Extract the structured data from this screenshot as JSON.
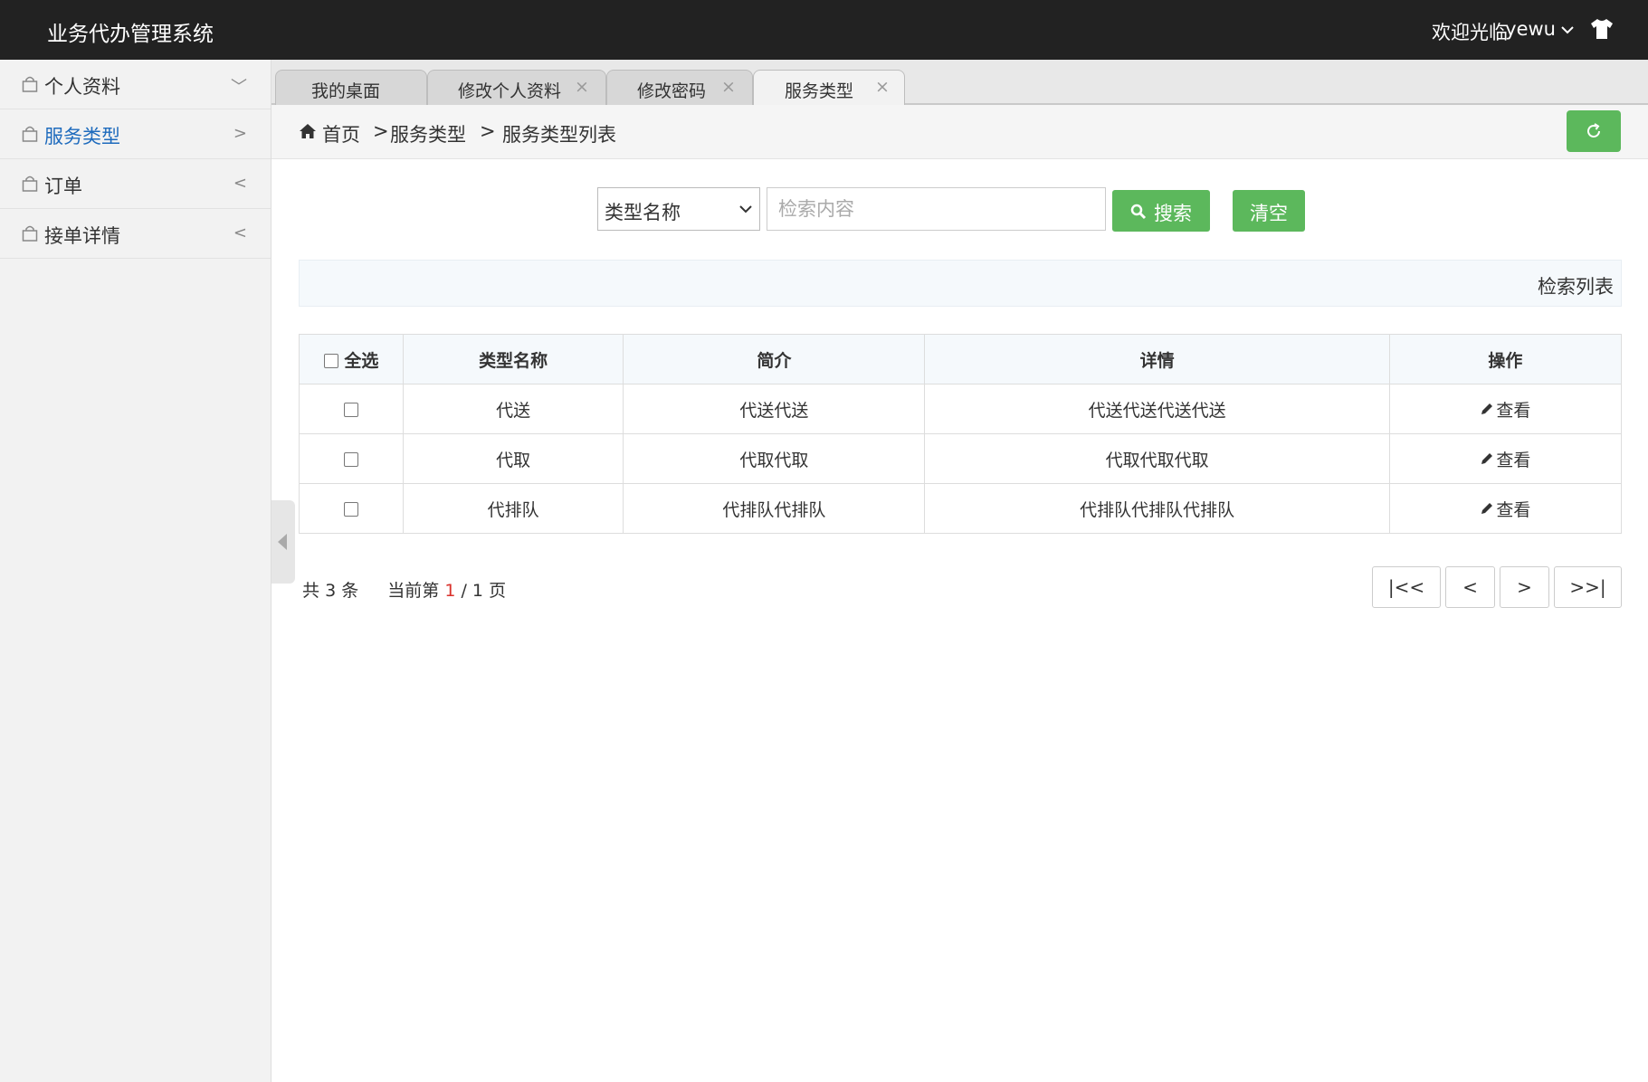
{
  "app": {
    "title": "业务代办管理系统",
    "welcome": "欢迎光临",
    "username": "yewu",
    "theme_icon": "tshirt-icon"
  },
  "sidebar": {
    "items": [
      {
        "label": "个人资料",
        "arrow": "﹀"
      },
      {
        "label": "服务类型",
        "arrow": ">"
      },
      {
        "label": "订单",
        "arrow": "<"
      },
      {
        "label": "接单详情",
        "arrow": "<"
      }
    ]
  },
  "tabs": [
    {
      "label": "我的桌面",
      "close": ""
    },
    {
      "label": "修改个人资料",
      "close": "×"
    },
    {
      "label": "修改密码",
      "close": "×"
    },
    {
      "label": "服务类型",
      "close": "×"
    }
  ],
  "breadcrumb": {
    "home": "首页",
    "sep1": ">",
    "level1": "服务类型",
    "sep2": ">",
    "level2": "服务类型列表"
  },
  "search": {
    "field_selected": "类型名称",
    "placeholder": "检索内容",
    "search_label": "搜索",
    "clear_label": "清空"
  },
  "list_title": "检索列表",
  "table": {
    "headers": {
      "select_all": "全选",
      "name": "类型名称",
      "intro": "简介",
      "detail": "详情",
      "action": "操作"
    },
    "rows": [
      {
        "name": "代送",
        "intro": "代送代送",
        "detail": "代送代送代送代送",
        "action": "查看"
      },
      {
        "name": "代取",
        "intro": "代取代取",
        "detail": "代取代取代取",
        "action": "查看"
      },
      {
        "name": "代排队",
        "intro": "代排队代排队",
        "detail": "代排队代排队代排队",
        "action": "查看"
      }
    ]
  },
  "pagination": {
    "total_prefix": "共",
    "total": "3",
    "total_suffix": "条",
    "current_prefix": "当前第",
    "current": "1",
    "slash": "/",
    "pages": "1",
    "pages_suffix": "页",
    "first": "|<<",
    "prev": "<",
    "next": ">",
    "last": ">>|"
  },
  "colors": {
    "accent": "#5cb85c",
    "topbar": "#222222",
    "active_link": "#1e6bbd",
    "current_page": "#d9322c"
  }
}
